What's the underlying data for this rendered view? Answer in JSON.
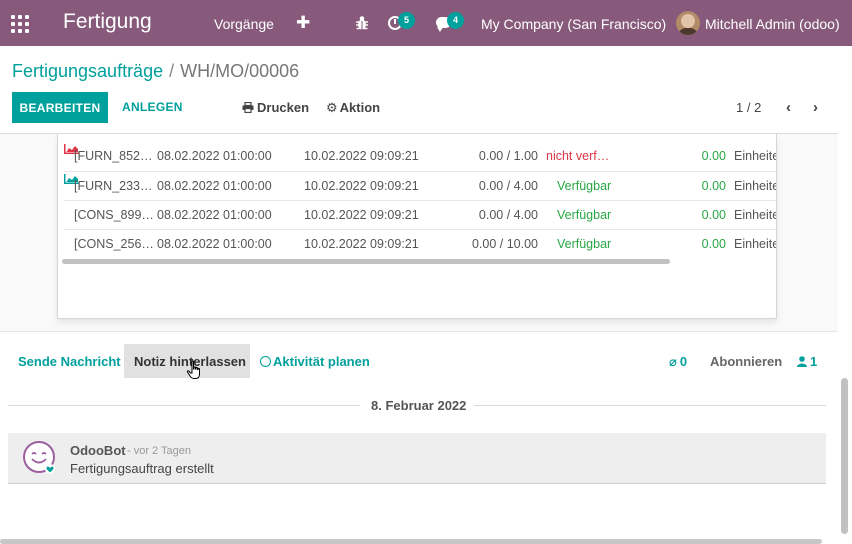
{
  "navbar": {
    "brand": "Fertigung",
    "menu_operations": "Vorgänge",
    "plus_icon": "✚",
    "activity_count": "5",
    "message_count": "4",
    "company": "My Company (San Francisco)",
    "user": "Mitchell Admin (odoo)"
  },
  "breadcrumb": {
    "parent": "Fertigungsaufträge",
    "separator": "/",
    "current": "WH/MO/00006"
  },
  "toolbar": {
    "edit_label": "BEARBEITEN",
    "create_label": "ANLEGEN",
    "print_label": "Drucken",
    "action_label": "Aktion",
    "pager_value": "1 / 2",
    "pager_prev": "‹",
    "pager_next": "›"
  },
  "components": [
    {
      "product": "[FURN_852…",
      "date_planned": "08.02.2022 01:00:00",
      "deadline": "10.02.2022 09:09:21",
      "quantity": "0.00 / 1.00",
      "availability": "nicht verf…",
      "availability_status": "unavailable",
      "consumed": "0.00",
      "uom": "Einheite"
    },
    {
      "product": "[FURN_233…",
      "date_planned": "08.02.2022 01:00:00",
      "deadline": "10.02.2022 09:09:21",
      "quantity": "0.00 / 4.00",
      "availability": "Verfügbar",
      "availability_status": "available",
      "consumed": "0.00",
      "uom": "Einheite"
    },
    {
      "product": "[CONS_899…",
      "date_planned": "08.02.2022 01:00:00",
      "deadline": "10.02.2022 09:09:21",
      "quantity": "0.00 / 4.00",
      "availability": "Verfügbar",
      "availability_status": "available",
      "consumed": "0.00",
      "uom": "Einheite"
    },
    {
      "product": "[CONS_256…",
      "date_planned": "08.02.2022 01:00:00",
      "deadline": "10.02.2022 09:09:21",
      "quantity": "0.00 / 10.00",
      "availability": "Verfügbar",
      "availability_status": "available",
      "consumed": "0.00",
      "uom": "Einheite"
    }
  ],
  "chatter": {
    "send_message": "Sende Nachricht",
    "log_note": "Notiz hinterlassen",
    "schedule_activity": "Aktivität planen",
    "attachments_count": "0",
    "subscribe": "Abonnieren",
    "followers_count": "1",
    "date_separator": "8. Februar 2022",
    "messages": [
      {
        "author": "OdooBot",
        "time": "- vor 2 Tagen",
        "body": "Fertigungsauftrag erstellt"
      }
    ]
  },
  "colors": {
    "brand": "#875a7b",
    "accent": "#00a09d",
    "danger": "#dc3545",
    "success": "#28a745"
  }
}
